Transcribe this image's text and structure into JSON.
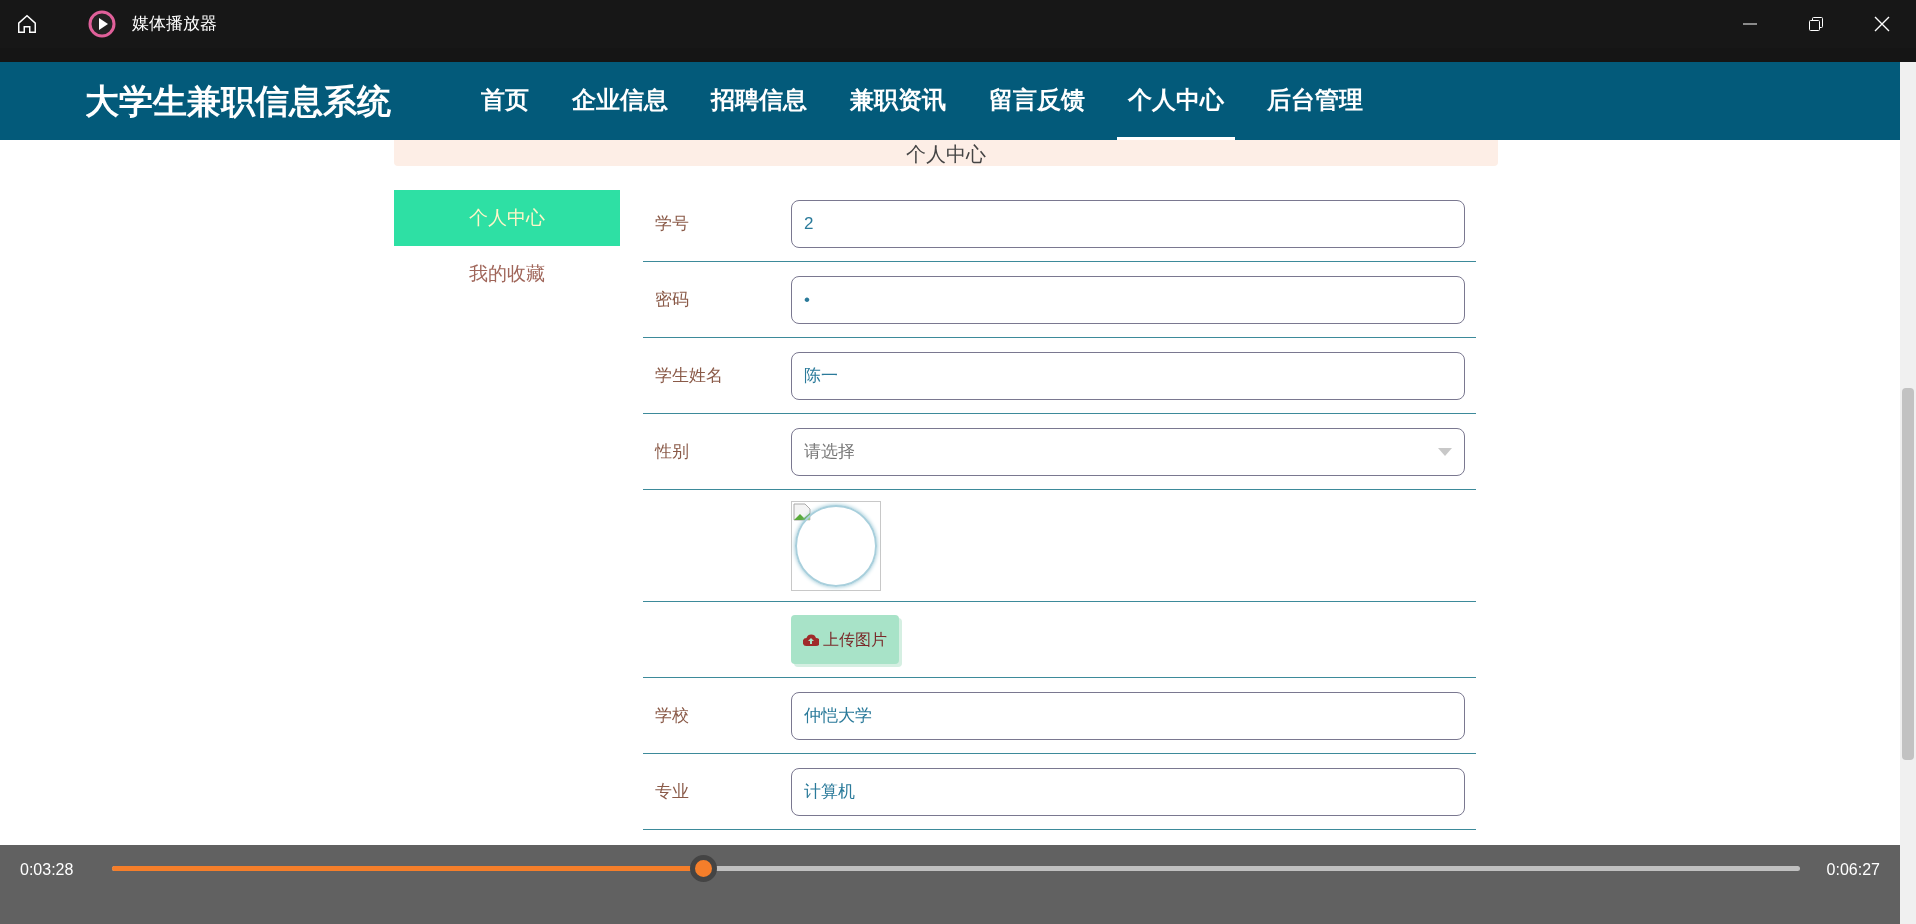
{
  "window": {
    "title": "媒体播放器"
  },
  "site": {
    "title": "大学生兼职信息系统",
    "nav": [
      {
        "label": "首页",
        "selected": false
      },
      {
        "label": "企业信息",
        "selected": false
      },
      {
        "label": "招聘信息",
        "selected": false
      },
      {
        "label": "兼职资讯",
        "selected": false
      },
      {
        "label": "留言反馈",
        "selected": false
      },
      {
        "label": "个人中心",
        "selected": true
      },
      {
        "label": "后台管理",
        "selected": false
      }
    ]
  },
  "page_heading": "个人中心",
  "sidebar": [
    {
      "label": "个人中心",
      "selected": true
    },
    {
      "label": "我的收藏",
      "selected": false
    }
  ],
  "form": [
    {
      "kind": "text",
      "label": "学号",
      "value": "2"
    },
    {
      "kind": "text",
      "label": "密码",
      "value": "•"
    },
    {
      "kind": "text",
      "label": "学生姓名",
      "value": "陈一"
    },
    {
      "kind": "select",
      "label": "性别",
      "placeholder": "请选择"
    },
    {
      "kind": "image"
    },
    {
      "kind": "upload",
      "button": "上传图片"
    },
    {
      "kind": "text",
      "label": "学校",
      "value": "仲恺大学"
    },
    {
      "kind": "text",
      "label": "专业",
      "value": "计算机"
    }
  ],
  "player": {
    "elapsed": "0:03:28",
    "total": "0:06:27",
    "level": 0.35
  }
}
